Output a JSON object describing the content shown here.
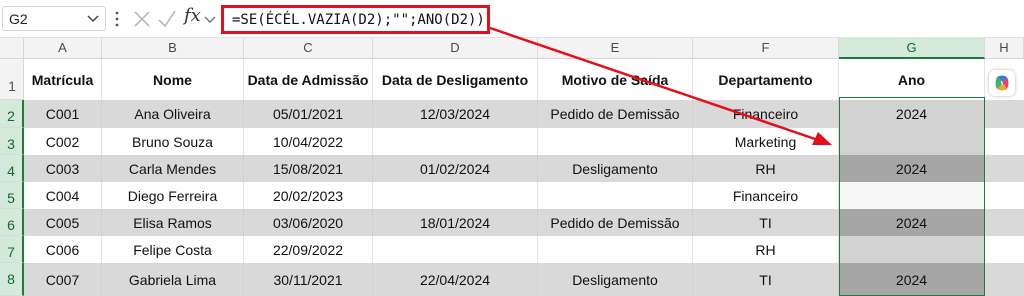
{
  "formula_bar": {
    "name_box": "G2",
    "fx_label": "fx",
    "formula": "=SE(ÉCÉL.VAZIA(D2);\"\";ANO(D2))"
  },
  "columns": [
    "A",
    "B",
    "C",
    "D",
    "E",
    "F",
    "G",
    "H"
  ],
  "selected_column": "G",
  "row_numbers": [
    "1",
    "2",
    "3",
    "4",
    "5",
    "6",
    "7",
    "8"
  ],
  "table": {
    "headers": [
      "Matrícula",
      "Nome",
      "Data de Admissão",
      "Data de Desligamento",
      "Motivo de Saída",
      "Departamento",
      "Ano"
    ],
    "rows": [
      [
        "C001",
        "Ana Oliveira",
        "05/01/2021",
        "12/03/2024",
        "Pedido de Demissão",
        "Financeiro",
        "2024"
      ],
      [
        "C002",
        "Bruno Souza",
        "10/04/2022",
        "",
        "",
        "Marketing",
        ""
      ],
      [
        "C003",
        "Carla Mendes",
        "15/08/2021",
        "01/02/2024",
        "Desligamento",
        "RH",
        "2024"
      ],
      [
        "C004",
        "Diego Ferreira",
        "20/02/2023",
        "",
        "",
        "Financeiro",
        ""
      ],
      [
        "C005",
        "Elisa Ramos",
        "03/06/2020",
        "18/01/2024",
        "Pedido de Demissão",
        "TI",
        "2024"
      ],
      [
        "C006",
        "Felipe Costa",
        "22/09/2022",
        "",
        "",
        "RH",
        ""
      ],
      [
        "C007",
        "Gabriela Lima",
        "30/11/2021",
        "22/04/2024",
        "Desligamento",
        "TI",
        "2024"
      ]
    ]
  },
  "colors": {
    "annotation_red": "#e3101b",
    "selection_green": "#1e7b3f",
    "band_gray": "#d9d9d9"
  },
  "icons": [
    "chevron-down-icon",
    "vertical-dots-icon",
    "cancel-x-icon",
    "check-icon",
    "fx-icon",
    "copilot-icon"
  ]
}
